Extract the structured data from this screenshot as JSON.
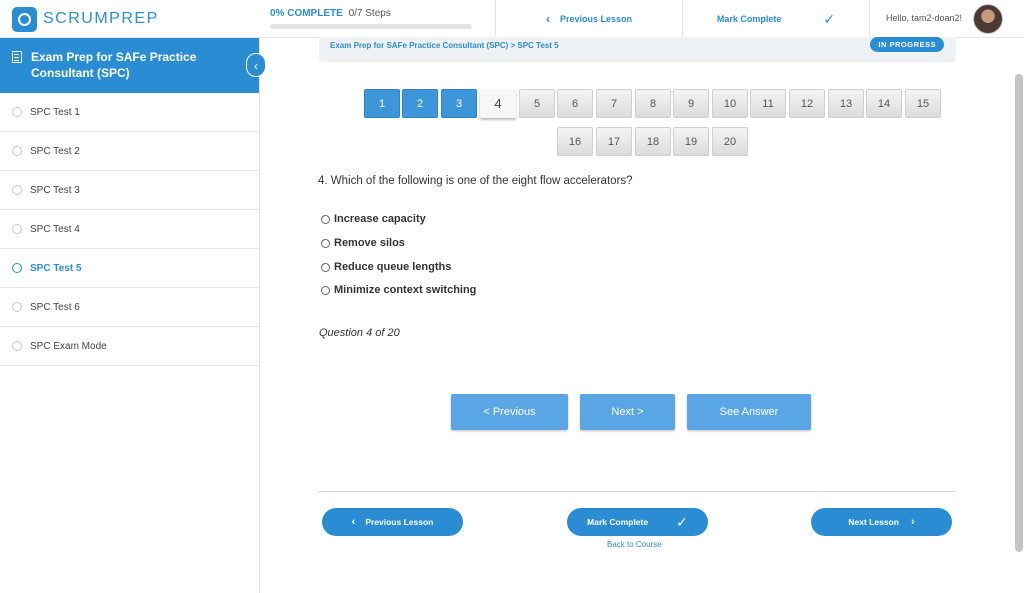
{
  "brand": {
    "name": "SCRUMPREP",
    "color": "#2a8dd4"
  },
  "progress": {
    "percent_label": "0% COMPLETE",
    "steps_label": "0/7 Steps",
    "value": 0
  },
  "topnav": {
    "previous_label": "Previous Lesson",
    "mark_complete_label": "Mark Complete",
    "greeting": "Hello, tam2-doan2!"
  },
  "sidebar": {
    "course_title": "Exam Prep for SAFe Practice Consultant (SPC)",
    "lessons": [
      {
        "label": "SPC Test 1",
        "active": false
      },
      {
        "label": "SPC Test 2",
        "active": false
      },
      {
        "label": "SPC Test 3",
        "active": false
      },
      {
        "label": "SPC Test 4",
        "active": false
      },
      {
        "label": "SPC Test 5",
        "active": true
      },
      {
        "label": "SPC Test 6",
        "active": false
      },
      {
        "label": "SPC Exam Mode",
        "active": false
      }
    ]
  },
  "breadcrumb": "Exam Prep for SAFe Practice Consultant (SPC) > SPC Test 5",
  "status_badge": "IN PROGRESS",
  "question_nav": {
    "numbers": [
      "1",
      "2",
      "3",
      "4",
      "5",
      "6",
      "7",
      "8",
      "9",
      "10",
      "11",
      "12",
      "13",
      "14",
      "15",
      "16",
      "17",
      "18",
      "19",
      "20"
    ],
    "answered": [
      1,
      2,
      3
    ],
    "current": 4
  },
  "question": {
    "text": "4. Which of the following is one of the eight flow accelerators?",
    "options": [
      "Increase capacity",
      "Remove silos",
      "Reduce queue lengths",
      "Minimize context switching"
    ],
    "counter": "Question 4 of 20"
  },
  "quiz_buttons": {
    "previous": "< Previous",
    "next": "Next >",
    "see_answer": "See Answer"
  },
  "footer": {
    "previous_lesson": "Previous Lesson",
    "mark_complete": "Mark Complete",
    "next_lesson": "Next Lesson",
    "back_to_course": "Back to Course"
  },
  "icons": {
    "chevron_left": "‹",
    "chevron_right": "›",
    "check": "✓"
  }
}
